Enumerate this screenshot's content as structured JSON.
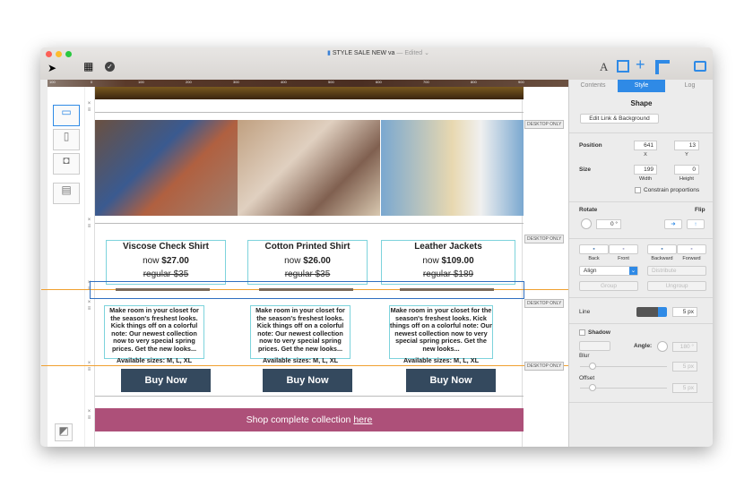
{
  "window": {
    "title": "STYLE SALE NEW va",
    "status": "— Edited ⌄"
  },
  "ruler": {
    "ticks": [
      "100",
      "0",
      "100",
      "200",
      "300",
      "400",
      "500",
      "600",
      "700",
      "800",
      "900"
    ]
  },
  "design": {
    "desktop_only": "DESKTOP ONLY",
    "products": [
      {
        "name": "Viscose Check Shirt",
        "now_label": "now",
        "now": "$27.00",
        "regular": "regular $35"
      },
      {
        "name": "Cotton Printed Shirt",
        "now_label": "now",
        "now": "$26.00",
        "regular": "regular $35"
      },
      {
        "name": "Leather Jackets",
        "now_label": "now",
        "now": "$109.00",
        "regular": "regular $189"
      }
    ],
    "description": "Make room in your closet for the season's freshest looks. Kick things off on a colorful note: Our newest collection now to very special spring prices. Get the new looks...",
    "sizes": "Available sizes: M, L, XL",
    "buy_label": "Buy Now",
    "banner_text": "Shop complete collection ",
    "banner_link": "here",
    "banner_color": "#ad5079",
    "button_color": "#34495e"
  },
  "panel": {
    "tabs": [
      "Contents",
      "Style",
      "Log"
    ],
    "active_tab": "Style",
    "shape_title": "Shape",
    "edit_link": "Edit Link & Background",
    "position_label": "Position",
    "x": "641",
    "y": "13",
    "x_label": "X",
    "y_label": "Y",
    "size_label": "Size",
    "width": "199",
    "height": "0",
    "width_label": "Width",
    "height_label": "Height",
    "constrain": "Constrain proportions",
    "rotate_label": "Rotate",
    "rotate": "0 °",
    "flip_label": "Flip",
    "arrange": [
      "Back",
      "Front",
      "Backward",
      "Forward"
    ],
    "align": "Align",
    "distribute": "Distribute",
    "group": "Group",
    "ungroup": "Ungroup",
    "line_label": "Line",
    "line_width": "5 px",
    "line_color": "#555555",
    "shadow": "Shadow",
    "angle_label": "Angle:",
    "angle": "180 °",
    "blur_label": "Blur",
    "blur": "5 px",
    "offset_label": "Offset",
    "offset": "5 px"
  }
}
